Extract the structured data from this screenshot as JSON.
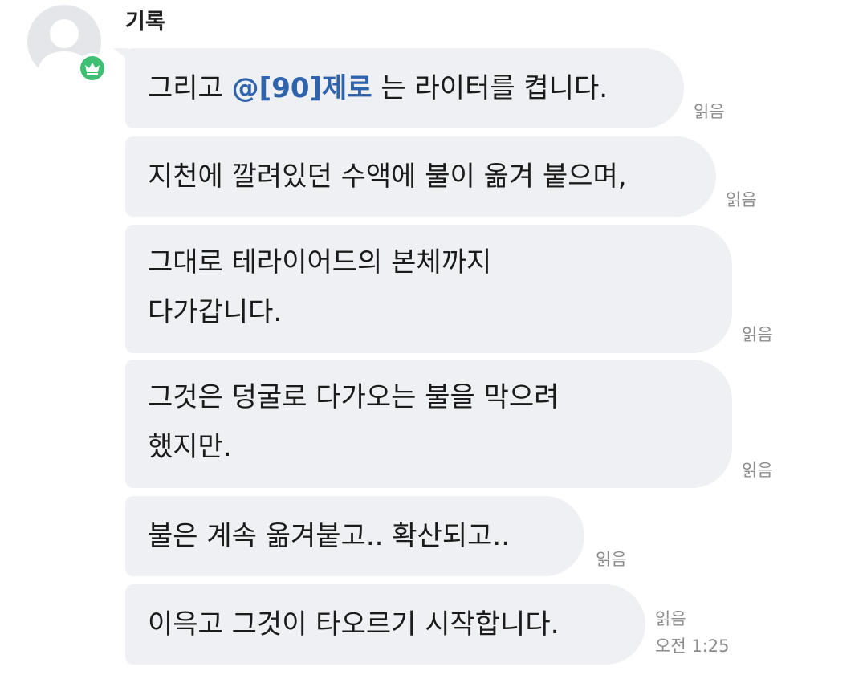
{
  "sender": {
    "name": "기록"
  },
  "messages": [
    {
      "segments": [
        {
          "text": "그리고 "
        },
        {
          "text": "@[90]제로",
          "mention": true
        },
        {
          "text": " 는 라이터를 켭니다."
        }
      ],
      "read": "읽음"
    },
    {
      "lines": [
        "지천에 깔려있던 수액에 불이 옮겨 붙으며,"
      ],
      "read": "읽음"
    },
    {
      "lines": [
        "그대로 테라이어드의 본체까지",
        "다가갑니다."
      ],
      "read": "읽음"
    },
    {
      "lines": [
        "그것은 덩굴로 다가오는 불을 막으려",
        "했지만."
      ],
      "read": "읽음"
    },
    {
      "lines": [
        "불은 계속 옮겨붙고.. 확산되고.."
      ],
      "read": "읽음"
    },
    {
      "lines": [
        "이윽고 그것이 타오르기 시작합니다."
      ],
      "read": "읽음",
      "time": "오전 1:25"
    }
  ],
  "colors": {
    "bubble": "#eff0f3",
    "mention": "#2f64ad",
    "badge": "#3fbf74",
    "meta_text": "#8c8c8c"
  },
  "icons": {
    "avatar": "default-user-silhouette",
    "badge": "crown-icon"
  }
}
